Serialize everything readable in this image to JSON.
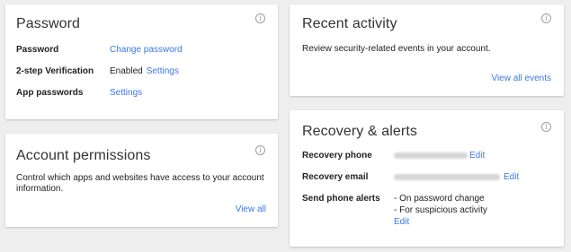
{
  "password_card": {
    "title": "Password",
    "rows": [
      {
        "label": "Password",
        "link": "Change password"
      },
      {
        "label": "2-step Verification",
        "value": "Enabled",
        "link": "Settings"
      },
      {
        "label": "App passwords",
        "link": "Settings"
      }
    ]
  },
  "permissions_card": {
    "title": "Account permissions",
    "description": "Control which apps and websites have access to your account information.",
    "link": "View all"
  },
  "activity_card": {
    "title": "Recent activity",
    "description": "Review security-related events in your account.",
    "link": "View all events"
  },
  "recovery_card": {
    "title": "Recovery & alerts",
    "phone_label": "Recovery phone",
    "phone_edit": "Edit",
    "email_label": "Recovery email",
    "email_edit": "Edit",
    "alerts_label": "Send phone alerts",
    "alerts": [
      "- On password change",
      "- For suspicious activity"
    ],
    "alerts_edit": "Edit"
  },
  "info_icon_glyph": "i",
  "colors": {
    "link": "#3b78e7",
    "background": "#eeeeee",
    "card": "#ffffff"
  }
}
